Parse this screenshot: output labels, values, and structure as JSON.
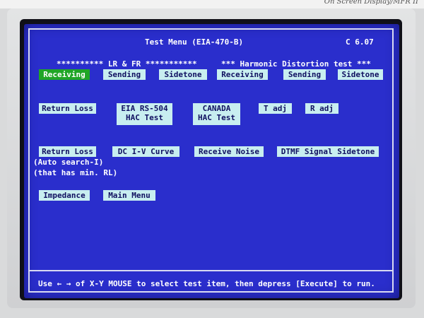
{
  "bezel_label": "On Screen Display/MFR II",
  "header": {
    "title": "Test Menu (EIA-470-B)",
    "version": "C 6.07"
  },
  "groups": {
    "lr_fr": "********** LR & FR ***********",
    "harmonic": "***  Harmonic Distortion test  ***"
  },
  "row1": [
    {
      "label": "Receiving",
      "active": true
    },
    {
      "label": "Sending"
    },
    {
      "label": "Sidetone"
    },
    {
      "label": "Receiving"
    },
    {
      "label": "Sending"
    },
    {
      "label": "Sidetone"
    }
  ],
  "row2": {
    "return_loss": "Return Loss",
    "eia_line1": "EIA RS-504",
    "eia_line2": "HAC Test",
    "canada_line1": "CANADA",
    "canada_line2": "HAC Test",
    "t_adj": "T adj",
    "r_adj": "R adj"
  },
  "row3": {
    "return_loss": "Return Loss",
    "dc_iv": "DC I-V Curve",
    "receive_noise": "Receive Noise",
    "dtmf": "DTMF Signal Sidetone",
    "note1": "(Auto search-I)",
    "note2": "(that has min. RL)"
  },
  "row4": {
    "impedance": "Impedance",
    "main_menu": "Main Menu"
  },
  "footer": "Use ← → of X-Y MOUSE to select test item, then depress [Execute] to run."
}
